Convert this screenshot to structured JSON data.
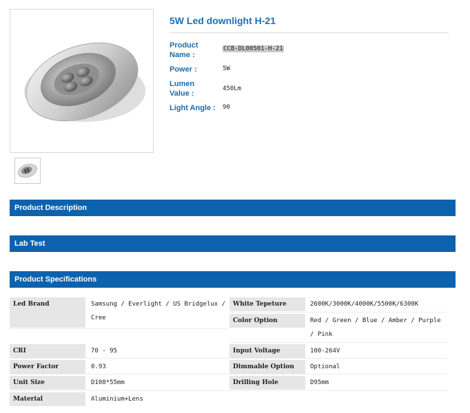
{
  "product": {
    "title": "5W Led downlight H-21",
    "fields": [
      {
        "label": "Product Name :",
        "value": "CCB-DL00501-H-21"
      },
      {
        "label": "Power :",
        "value": "5W"
      },
      {
        "label": "Lumen Value :",
        "value": "450Lm"
      },
      {
        "label": "Light Angle :",
        "value": "90"
      }
    ]
  },
  "sections": {
    "description": "Product Description",
    "lab_test": "Lab Test",
    "specifications": "Product Specifications"
  },
  "specs_left": [
    {
      "label": "Led Brand",
      "value": "Samsung / Everlight / US Bridgelux / Cree"
    },
    {
      "label": "CRI",
      "value": "70 - 95"
    },
    {
      "label": "Power Factor",
      "value": "0.93"
    },
    {
      "label": "Unit Size",
      "value": "D108*55mm"
    },
    {
      "label": "Material",
      "value": "Aluminium+Lens"
    }
  ],
  "specs_right": [
    {
      "label": "White Tepeture",
      "value": "2600K/3000K/4000K/5500K/6300K"
    },
    {
      "label": "Color Option",
      "value": "Red / Green / Blue / Amber / Purple / Pink"
    },
    {
      "label": "Input Voltage",
      "value": "100-264V"
    },
    {
      "label": "Dimmable Option",
      "value": "Optional"
    },
    {
      "label": "Drilling Hole",
      "value": "D95mm"
    }
  ],
  "colors": {
    "accent": "#0c62ac",
    "title": "#1d6fb5",
    "label_bg": "#e6e6e6"
  }
}
